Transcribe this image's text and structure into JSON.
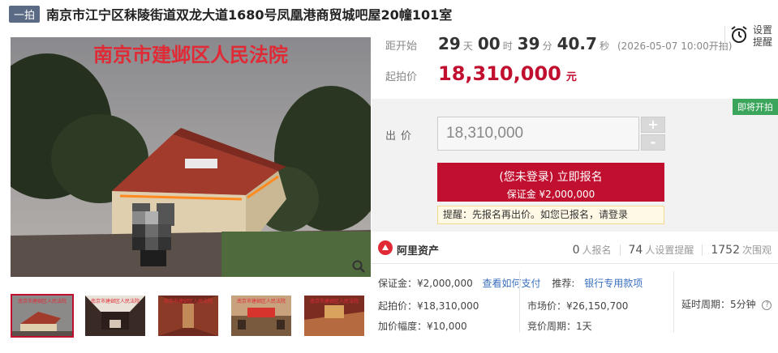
{
  "header": {
    "round_badge": "一拍",
    "title": "南京市江宁区秣陵街道双龙大道1680号凤凰港商贸城吧屋20幢101室"
  },
  "image": {
    "banner_text": "南京市建邺区人民法院"
  },
  "countdown": {
    "label": "距开始",
    "days": "29",
    "days_unit": "天",
    "hours": "00",
    "hours_unit": "时",
    "minutes": "39",
    "minutes_unit": "分",
    "seconds": "40.7",
    "seconds_unit": "秒",
    "start_note": "(2026-05-07 10:00开拍)"
  },
  "reminder": {
    "label": "设置提醒",
    "icon": "alarm-clock-icon"
  },
  "start_price": {
    "label": "起拍价",
    "value": "18,310,000",
    "unit": "元"
  },
  "bid": {
    "status_badge": "即将开拍",
    "label": "出价",
    "input_value": "18,310,000",
    "plus": "+",
    "minus": "-",
    "signup_main": "(您未登录) 立即报名",
    "signup_deposit": "保证金 ¥2,000,000",
    "notice": "提醒：先报名再出价。如您已报名，请登录"
  },
  "platform": {
    "name": "阿里资产",
    "icon": "ali-asset-logo-icon"
  },
  "stats": {
    "signups": "0",
    "signups_label": "人报名",
    "reminders": "74",
    "reminders_label": "人设置提醒",
    "views": "1752",
    "views_label": "次围观"
  },
  "details": {
    "deposit": "保证金：¥2,000,000",
    "deposit_link": "查看如何支付",
    "recommend_label": "推荐:",
    "recommend_link": "银行专用款项",
    "start_price": "起拍价：¥18,310,000",
    "increment": "加价幅度：¥10,000",
    "market_price": "市场价：¥26,150,700",
    "bid_cycle": "竞价周期：1天",
    "delay_cycle": "延时周期：5分钟"
  },
  "colors": {
    "brand_red": "#c1102f",
    "soon_green": "#3aa55b",
    "link_blue": "#3a6fbf"
  }
}
